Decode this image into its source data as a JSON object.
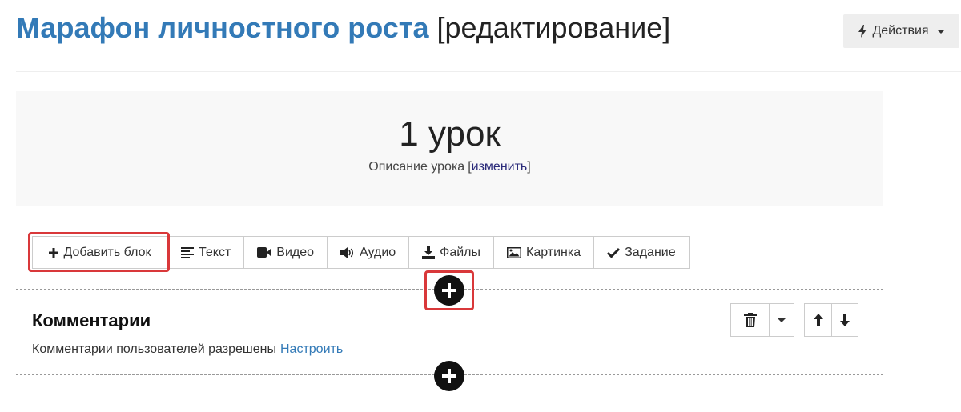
{
  "header": {
    "title": "Марафон личностного роста",
    "title_suffix": "[редактирование]",
    "actions_label": "Действия"
  },
  "lesson": {
    "title": "1 урок",
    "description": "Описание урока",
    "edit_open": "[",
    "edit_label": "изменить",
    "edit_close": "]"
  },
  "toolbar": {
    "items": [
      {
        "label": "Добавить блок",
        "icon": "plus-icon"
      },
      {
        "label": "Текст",
        "icon": "align-left-icon"
      },
      {
        "label": "Видео",
        "icon": "video-camera-icon"
      },
      {
        "label": "Аудио",
        "icon": "volume-icon"
      },
      {
        "label": "Файлы",
        "icon": "download-icon"
      },
      {
        "label": "Картинка",
        "icon": "picture-icon"
      },
      {
        "label": "Задание",
        "icon": "checkmark-icon"
      }
    ]
  },
  "comments": {
    "title": "Комментарии",
    "status": "Комментарии пользователей разрешены",
    "configure_label": "Настроить"
  },
  "colors": {
    "accent": "#337ab7",
    "highlight": "#d9383a",
    "panel": "#f8f8f8"
  }
}
